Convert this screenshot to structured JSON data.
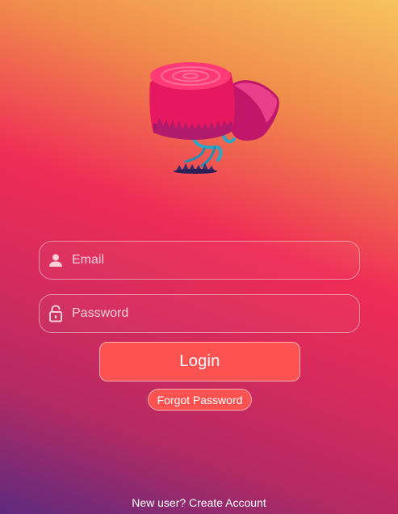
{
  "logo": {
    "icon": "tree-stump-logo-icon"
  },
  "form": {
    "email": {
      "placeholder": "Email",
      "value": "",
      "icon": "user-icon"
    },
    "password": {
      "placeholder": "Password",
      "value": "",
      "icon": "lock-icon"
    },
    "login_label": "Login",
    "forgot_label": "Forgot Password"
  },
  "footer": {
    "prompt": "New user?",
    "create_label": "Create Account"
  },
  "colors": {
    "button": "#fc5252",
    "gradient_top": "#f7c35f",
    "gradient_mid": "#ef2d56",
    "gradient_bottom": "#5e2a7e"
  }
}
